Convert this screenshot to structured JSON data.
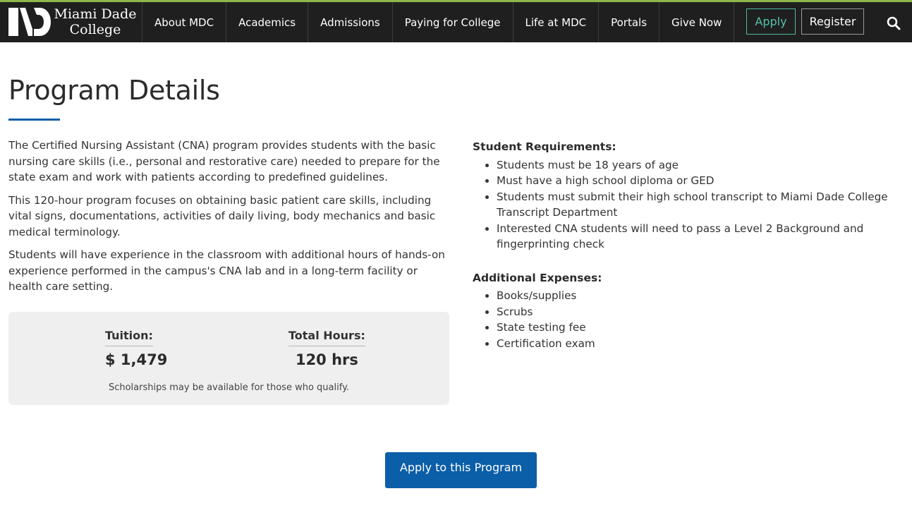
{
  "header": {
    "logo_line1": "Miami Dade",
    "logo_line2": "College",
    "nav": [
      {
        "label": "About MDC"
      },
      {
        "label": "Academics"
      },
      {
        "label": "Admissions"
      },
      {
        "label": "Paying for College"
      },
      {
        "label": "Life at MDC"
      },
      {
        "label": "Portals"
      },
      {
        "label": "Give Now"
      }
    ],
    "apply_label": "Apply",
    "register_label": "Register",
    "search_icon": "search-icon"
  },
  "main": {
    "title": "Program Details",
    "paragraphs": [
      "The Certified Nursing Assistant (CNA) program provides students with the basic nursing care skills (i.e., personal and restorative care) needed to prepare for the state exam and work with patients according to predefined guidelines.",
      "This 120-hour program focuses on obtaining basic patient care skills, including vital signs, documentations, activities of daily living, body mechanics and basic medical terminology.",
      "Students will have experience in the classroom with additional hours of hands-on experience performed in the campus's CNA lab and in a long-term facility or health care setting."
    ],
    "info": {
      "tuition_label": "Tuition:",
      "tuition_value": "$ 1,479",
      "hours_label": "Total Hours:",
      "hours_value": "120 hrs",
      "note": "Scholarships may be available for those who qualify."
    },
    "requirements": {
      "heading": "Student Requirements:",
      "items": [
        "Students must be 18 years of age",
        "Must have a high school diploma or GED",
        "Students must submit their high school transcript to Miami Dade College Transcript Department",
        "Interested CNA students will need to pass a Level 2 Background and fingerprinting check"
      ]
    },
    "expenses": {
      "heading": "Additional Expenses:",
      "items": [
        "Books/supplies",
        "Scrubs",
        "State testing fee",
        "Certification exam"
      ]
    },
    "cta_label": "Apply to this Program"
  },
  "colors": {
    "topbar": "#1f1f1f",
    "accent_top": "#8fb74a",
    "apply_teal": "#56c2ab",
    "brand_blue": "#0b5ea8",
    "info_bg": "#efefef"
  }
}
